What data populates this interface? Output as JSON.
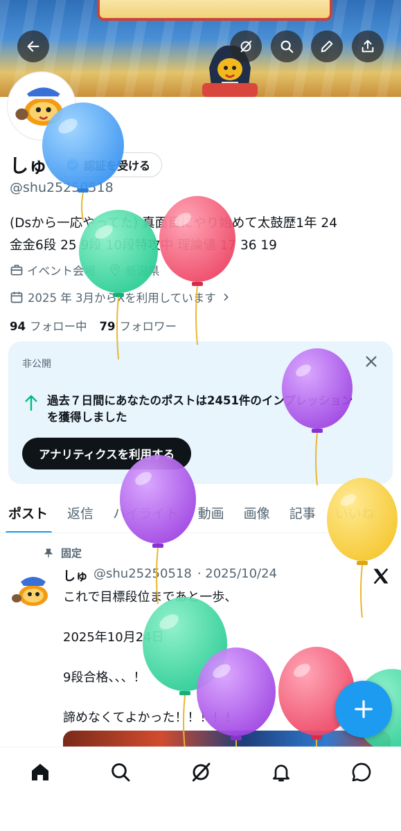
{
  "header": {
    "back_icon": "arrow-left-icon",
    "grok_icon": "grok-icon",
    "search_icon": "search-icon",
    "edit_icon": "pencil-icon",
    "share_icon": "share-icon"
  },
  "profile": {
    "name": "しゅ",
    "verify_label": "認証を受ける",
    "handle": "@shu25250518",
    "bio_line1": "(Dsから一応やってた) 真面目にやり始めて太鼓歴1年 24",
    "bio_line2": "金金6段 25 9段 10段特攻中 理論値 17 36 19",
    "location_label": "イベント会場",
    "region": "新潟県",
    "joined": "2025 年 3月からXを利用しています",
    "following_count": "94",
    "following_label": "フォロー中",
    "followers_count": "79",
    "followers_label": "フォロワー"
  },
  "analytics_card": {
    "private_label": "非公開",
    "impressions_line1": "過去７日間にあなたのポストは2451件のインプレッション",
    "impressions_line2": "を獲得しました",
    "cta_label": "アナリティクスを利用する"
  },
  "tabs": [
    "ポスト",
    "返信",
    "ハイライト",
    "動画",
    "画像",
    "記事",
    "いいね"
  ],
  "pinned_post": {
    "pinned_label": "固定",
    "author_name": "しゅ",
    "author_handle": "@shu25250518",
    "date": "· 2025/10/24",
    "lines": [
      "これで目標段位まであと一歩、",
      "2025年10月24日",
      "9段合格、、、！",
      "諦めなくてよかった！！！！！"
    ]
  },
  "bottom_nav": [
    "home-icon",
    "search-icon",
    "grok-icon",
    "bell-icon",
    "messages-icon"
  ],
  "colors": {
    "accent": "#1d9bf0",
    "card_bg": "#e8f5fd",
    "text_secondary": "#536471",
    "up_arrow": "#00ba7c"
  }
}
